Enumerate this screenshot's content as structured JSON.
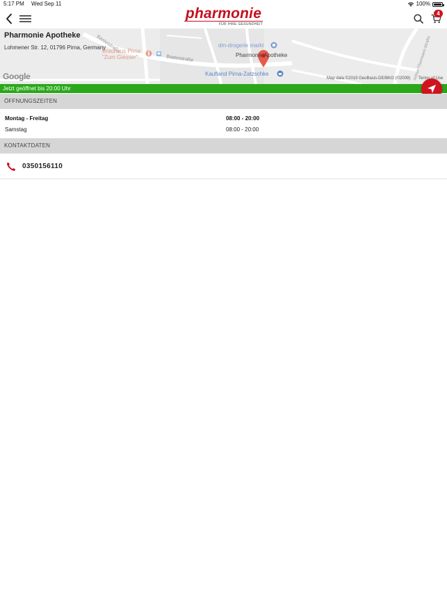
{
  "status_bar": {
    "time": "5:17 PM",
    "date": "Wed Sep 11",
    "battery": "100%"
  },
  "header": {
    "logo_text": "pharmonie",
    "logo_tagline": "FÜR IHRE GESUNDHEIT",
    "cart_count": "4"
  },
  "map": {
    "store_name": "Pharmonie Apotheke",
    "address": "Lohmener Str. 12, 01796 Pirna, Germany",
    "poi_dm": "dm-drogerie markt",
    "poi_pharmacy": "Pharmonie Apotheke",
    "poi_brauhaus_line1": "Brauhaus Pirna",
    "poi_brauhaus_line2": "\"Zum Giesser\"",
    "poi_kaufland": "Kaufland Pirna-Zatzschke",
    "street_basteistrasse": "Basteistraße",
    "street_basteistrasse_upper": "Basteistraße",
    "street_arthur": "Arthur-Thiermann-Straße",
    "provider": "Google",
    "attribution": "Map data ©2019 GeoBasis-DE/BKG (©2009)",
    "terms": "Terms of Use"
  },
  "open_status": "Jetzt geöffnet bis 20:00 Uhr",
  "hours_section": {
    "title": "ÖFFNUNGSZEITEN",
    "rows": [
      {
        "day": "Montag - Freitag",
        "time": "08:00 - 20:00"
      },
      {
        "day": "Samstag",
        "time": "08:00 - 20:00"
      }
    ]
  },
  "contact_section": {
    "title": "KONTAKTDATEN",
    "phone": "0350156110"
  },
  "colors": {
    "brand_red": "#c4101e",
    "open_green": "#2aa81a",
    "section_gray": "#d6d6d6"
  },
  "icons": [
    "back-chevron-icon",
    "menu-icon",
    "search-icon",
    "cart-icon",
    "navigation-arrow-icon",
    "phone-icon",
    "map-pin-icon"
  ]
}
